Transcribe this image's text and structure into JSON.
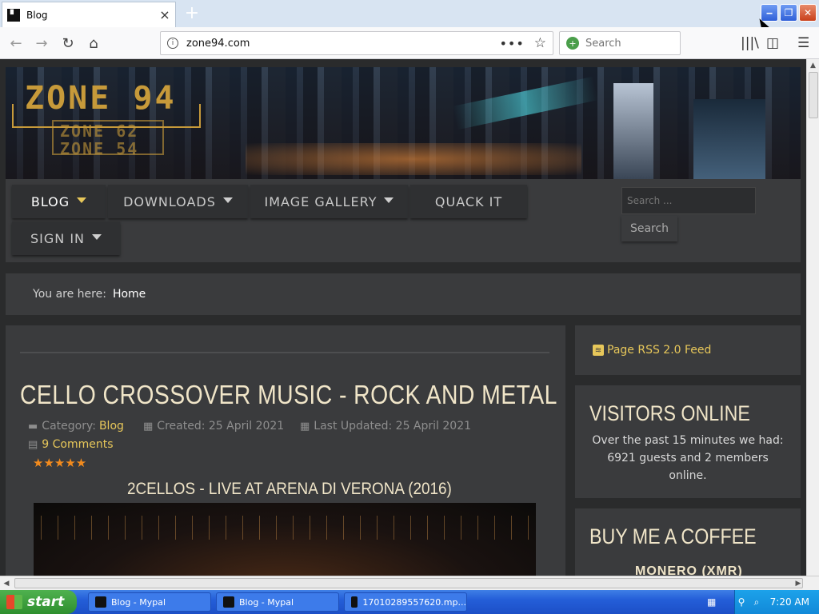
{
  "browser": {
    "tab_title": "Blog",
    "new_tab": "+",
    "url": "zone94.com",
    "search_placeholder": "Search",
    "win_min": "‒",
    "win_max": "❐",
    "win_close": "✕"
  },
  "site": {
    "logo_main": "ZONE 94",
    "logo_sub1": "ZONE 62",
    "logo_sub2": "ZONE 54",
    "menu": [
      {
        "label": "BLOG",
        "has_dropdown": true,
        "active": true
      },
      {
        "label": "DOWNLOADS",
        "has_dropdown": true
      },
      {
        "label": "IMAGE GALLERY",
        "has_dropdown": true
      },
      {
        "label": "QUACK IT",
        "has_dropdown": false
      },
      {
        "label": "SIGN IN",
        "has_dropdown": true
      }
    ],
    "search_placeholder": "Search ...",
    "search_button": "Search",
    "breadcrumb_label": "You are here:",
    "breadcrumb_home": "Home"
  },
  "article": {
    "title": "CELLO CROSSOVER MUSIC - ROCK AND METAL",
    "category_label": "Category:",
    "category": "Blog",
    "created": "Created: 25 April 2021",
    "updated": "Last Updated: 25 April 2021",
    "comments": "9 Comments",
    "rating": 5,
    "stars": "★★★★★",
    "video_title": "2CELLOS - LIVE AT ARENA DI VERONA (2016)"
  },
  "sidebar": {
    "rss": "Page RSS 2.0 Feed",
    "visitors_title": "VISITORS ONLINE",
    "visitors_text": "Over the past 15 minutes we had: 6921 guests and 2 members online.",
    "coffee_title": "BUY ME A COFFEE",
    "coffee_sub": "MONERO (XMR)"
  },
  "taskbar": {
    "start": "start",
    "items": [
      "Blog - Mypal",
      "Blog - Mypal",
      "17010289557620.mp..."
    ],
    "time": "7:20 AM"
  },
  "colors": {
    "accent": "#e7c75a",
    "page_bg": "#2a2b2c",
    "panel": "#3a3b3d",
    "star": "#f28b1e"
  }
}
